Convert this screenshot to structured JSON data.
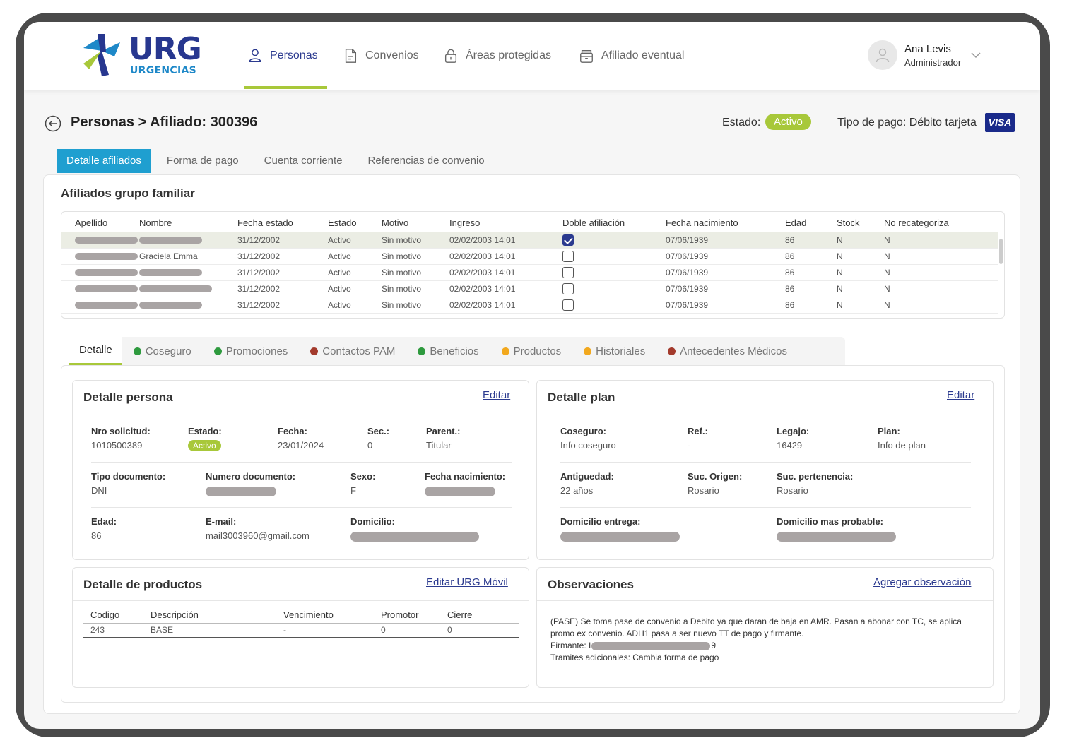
{
  "brand": {
    "name": "URG",
    "subtitle": "URGENCIAS"
  },
  "nav": [
    {
      "label": "Personas",
      "icon": "person-icon",
      "active": true
    },
    {
      "label": "Convenios",
      "icon": "document-icon"
    },
    {
      "label": "Áreas protegidas",
      "icon": "lock-icon"
    },
    {
      "label": "Afiliado eventual",
      "icon": "archive-icon"
    }
  ],
  "user": {
    "name": "Ana Levis",
    "role": "Administrador"
  },
  "page": {
    "title": "Personas > Afiliado: 300396",
    "estado_label": "Estado:",
    "estado_value": "Activo",
    "pago_label": "Tipo de pago: Débito tarjeta",
    "card_brand": "VISA"
  },
  "main_tabs": [
    "Detalle afiliados",
    "Forma de pago",
    "Cuenta corriente",
    "Referencias de convenio"
  ],
  "grupo": {
    "title": "Afiliados grupo familiar",
    "columns": [
      "Apellido",
      "Nombre",
      "Fecha estado",
      "Estado",
      "Motivo",
      "Ingreso",
      "Doble afiliación",
      "Fecha nacimiento",
      "Edad",
      "Stock",
      "No recategoriza"
    ],
    "rows": [
      {
        "nombre": "",
        "fecha_estado": "31/12/2002",
        "estado": "Activo",
        "motivo": "Sin motivo",
        "ingreso": "02/02/2003 14:01",
        "doble": true,
        "nacimiento": "07/06/1939",
        "edad": "86",
        "stock": "N",
        "norecat": "N"
      },
      {
        "nombre": "Graciela Emma",
        "fecha_estado": "31/12/2002",
        "estado": "Activo",
        "motivo": "Sin motivo",
        "ingreso": "02/02/2003 14:01",
        "doble": false,
        "nacimiento": "07/06/1939",
        "edad": "86",
        "stock": "N",
        "norecat": "N"
      },
      {
        "nombre": "",
        "fecha_estado": "31/12/2002",
        "estado": "Activo",
        "motivo": "Sin motivo",
        "ingreso": "02/02/2003 14:01",
        "doble": false,
        "nacimiento": "07/06/1939",
        "edad": "86",
        "stock": "N",
        "norecat": "N"
      },
      {
        "nombre": "",
        "fecha_estado": "31/12/2002",
        "estado": "Activo",
        "motivo": "Sin motivo",
        "ingreso": "02/02/2003 14:01",
        "doble": false,
        "nacimiento": "07/06/1939",
        "edad": "86",
        "stock": "N",
        "norecat": "N"
      },
      {
        "nombre": "",
        "fecha_estado": "31/12/2002",
        "estado": "Activo",
        "motivo": "Sin motivo",
        "ingreso": "02/02/2003 14:01",
        "doble": false,
        "nacimiento": "07/06/1939",
        "edad": "86",
        "stock": "N",
        "norecat": "N"
      }
    ]
  },
  "sub_tabs": [
    {
      "label": "Detalle",
      "active": true
    },
    {
      "label": "Coseguro",
      "dot": "#2e9a3e"
    },
    {
      "label": "Promociones",
      "dot": "#2e9a3e"
    },
    {
      "label": "Contactos PAM",
      "dot": "#a33a2c"
    },
    {
      "label": "Beneficios",
      "dot": "#2e9a3e"
    },
    {
      "label": "Productos",
      "dot": "#f2a81d"
    },
    {
      "label": "Historiales",
      "dot": "#f2a81d"
    },
    {
      "label": "Antecedentes Médicos",
      "dot": "#a33a2c"
    }
  ],
  "detalle_persona": {
    "title": "Detalle persona",
    "edit": "Editar",
    "nro_solicitud": {
      "label": "Nro solicitud:",
      "value": "1010500389"
    },
    "estado": {
      "label": "Estado:",
      "value": "Activo"
    },
    "fecha": {
      "label": "Fecha:",
      "value": "23/01/2024"
    },
    "sec": {
      "label": "Sec.:",
      "value": "0"
    },
    "parent": {
      "label": "Parent.:",
      "value": "Titular"
    },
    "tipo_doc": {
      "label": "Tipo documento:",
      "value": "DNI"
    },
    "num_doc": {
      "label": "Numero documento:"
    },
    "sexo": {
      "label": "Sexo:",
      "value": "F"
    },
    "fecha_nac": {
      "label": "Fecha nacimiento:"
    },
    "edad": {
      "label": "Edad:",
      "value": "86"
    },
    "email": {
      "label": "E-mail:",
      "value": "mail3003960@gmail.com"
    },
    "domicilio": {
      "label": "Domicilio:"
    }
  },
  "detalle_plan": {
    "title": "Detalle plan",
    "edit": "Editar",
    "coseguro": {
      "label": "Coseguro:",
      "value": "Info coseguro"
    },
    "ref": {
      "label": "Ref.:",
      "value": "-"
    },
    "legajo": {
      "label": "Legajo:",
      "value": "16429"
    },
    "plan": {
      "label": "Plan:",
      "value": "Info de plan"
    },
    "antiguedad": {
      "label": "Antiguedad:",
      "value": "22 años"
    },
    "suc_origen": {
      "label": "Suc. Origen:",
      "value": "Rosario"
    },
    "suc_pert": {
      "label": "Suc. pertenencia:",
      "value": "Rosario"
    },
    "dom_entrega": {
      "label": "Domicilio entrega:"
    },
    "dom_probable": {
      "label": "Domicilio mas probable:"
    }
  },
  "productos": {
    "title": "Detalle de productos",
    "edit": "Editar URG Móvil",
    "columns": [
      "Codigo",
      "Descripción",
      "Vencimiento",
      "Promotor",
      "Cierre"
    ],
    "rows": [
      [
        "243",
        "BASE",
        "-",
        "0",
        "0"
      ]
    ]
  },
  "observaciones": {
    "title": "Observaciones",
    "add": "Agregar observación",
    "line1": "(PASE) Se toma pase de convenio a Debito ya que daran de baja en AMR. Pasan a abonar con TC, se aplica",
    "line2": "promo ex convenio. ADH1 pasa a ser nuevo TT de pago y firmante.",
    "firmante_label": "Firmante: I",
    "firmante_suffix": "9",
    "line4": "Tramites adicionales: Cambia forma de pago"
  }
}
